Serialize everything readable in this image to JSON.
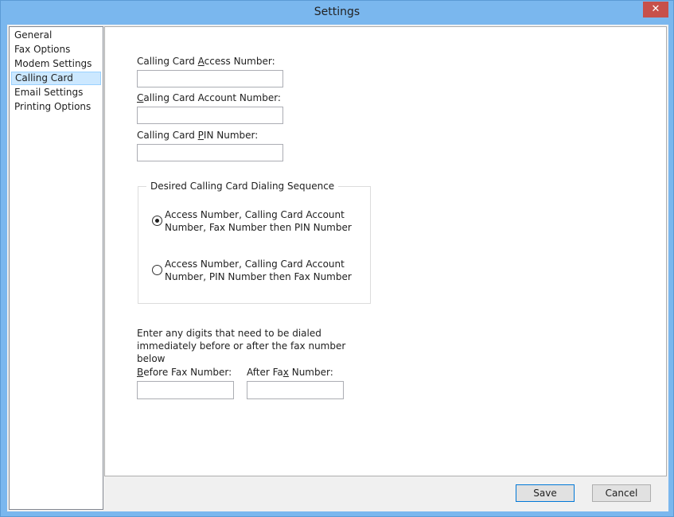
{
  "window": {
    "title": "Settings"
  },
  "sidebar": {
    "items": [
      {
        "label": "General",
        "selected": false
      },
      {
        "label": "Fax Options",
        "selected": false
      },
      {
        "label": "Modem Settings",
        "selected": false
      },
      {
        "label": "Calling Card",
        "selected": true
      },
      {
        "label": "Email Settings",
        "selected": false
      },
      {
        "label": "Printing Options",
        "selected": false
      }
    ]
  },
  "calling_card": {
    "access_number": {
      "label_pre": "Calling Card ",
      "label_key": "A",
      "label_post": "ccess Number:",
      "value": ""
    },
    "account_number": {
      "label_pre": "",
      "label_key": "C",
      "label_post": "alling Card Account Number:",
      "value": ""
    },
    "pin_number": {
      "label_pre": "Calling Card ",
      "label_key": "P",
      "label_post": "IN Number:",
      "value": ""
    },
    "sequence": {
      "title": "Desired Calling Card Dialing Sequence",
      "options": [
        {
          "label": "Access Number, Calling Card Account Number, Fax Number then PIN Number",
          "selected": true
        },
        {
          "label": "Access Number, Calling Card Account Number, PIN Number then Fax Number",
          "selected": false
        }
      ]
    },
    "digits_instructions": "Enter any digits that need to be dialed immediately before or after the fax number below",
    "before_fax": {
      "label_pre": "",
      "label_key": "B",
      "label_post": "efore Fax Number:",
      "value": ""
    },
    "after_fax": {
      "label_pre": "After Fa",
      "label_key": "x",
      "label_post": " Number:",
      "value": ""
    }
  },
  "buttons": {
    "save": "Save",
    "cancel": "Cancel"
  },
  "icons": {
    "close": "close-icon"
  }
}
